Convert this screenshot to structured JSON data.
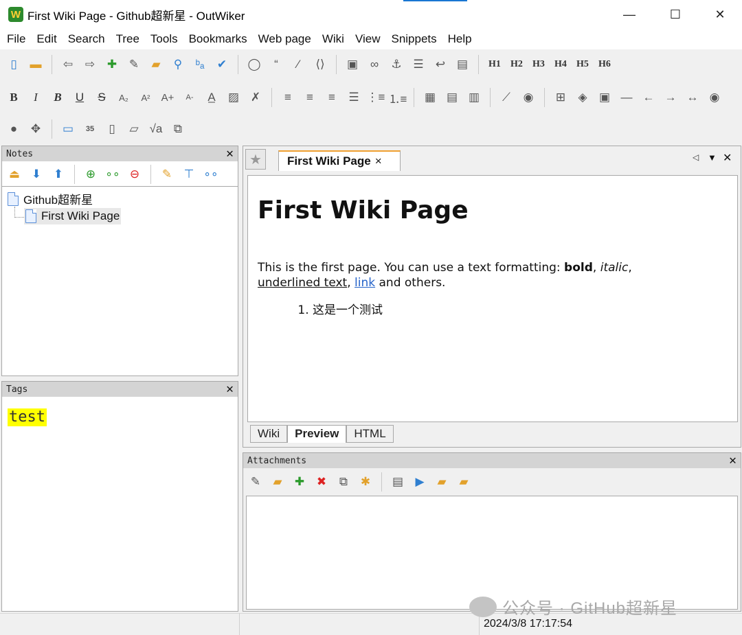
{
  "window": {
    "title": "First Wiki Page - Github超新星 - OutWiker",
    "app_icon_text": "W",
    "minimize": "—",
    "maximize": "☐",
    "close": "✕"
  },
  "menu": [
    "File",
    "Edit",
    "Search",
    "Tree",
    "Tools",
    "Bookmarks",
    "Web page",
    "Wiki",
    "View",
    "Snippets",
    "Help"
  ],
  "toolbar": {
    "headings": [
      "H1",
      "H2",
      "H3",
      "H4",
      "H5",
      "H6"
    ],
    "bold": "B",
    "italic": "I",
    "bold_italic": "B",
    "underline": "U",
    "strike": "S",
    "subscript": "A₂",
    "superscript": "A²",
    "font_bigger": "A+",
    "font_smaller": "A-",
    "math": "√a"
  },
  "notes_panel": {
    "title": "Notes",
    "close": "✕",
    "tree": [
      {
        "label": "Github超新星",
        "level": 0
      },
      {
        "label": "First Wiki Page",
        "level": 1,
        "selected": true
      }
    ]
  },
  "tags_panel": {
    "title": "Tags",
    "close": "✕",
    "tags": [
      "test"
    ]
  },
  "editor": {
    "tab_title": "First Wiki Page",
    "tab_close": "×",
    "heading": "First Wiki Page",
    "p_before": "This is the first page. You can use a text formatting: ",
    "bold_word": "bold",
    "comma1": ", ",
    "italic_word": "italic",
    "comma2": ",",
    "underlined_text": "underlined text",
    "comma3": ", ",
    "link_text": "link",
    "p_after": " and others.",
    "list_items": [
      "这是一个测试"
    ],
    "mode_tabs": [
      "Wiki",
      "Preview",
      "HTML"
    ],
    "active_mode": "Preview"
  },
  "attachments_panel": {
    "title": "Attachments",
    "close": "✕"
  },
  "status": {
    "datetime": "2024/3/8 17:17:54"
  },
  "watermark": {
    "text": "公众号 · GitHub超新星"
  }
}
